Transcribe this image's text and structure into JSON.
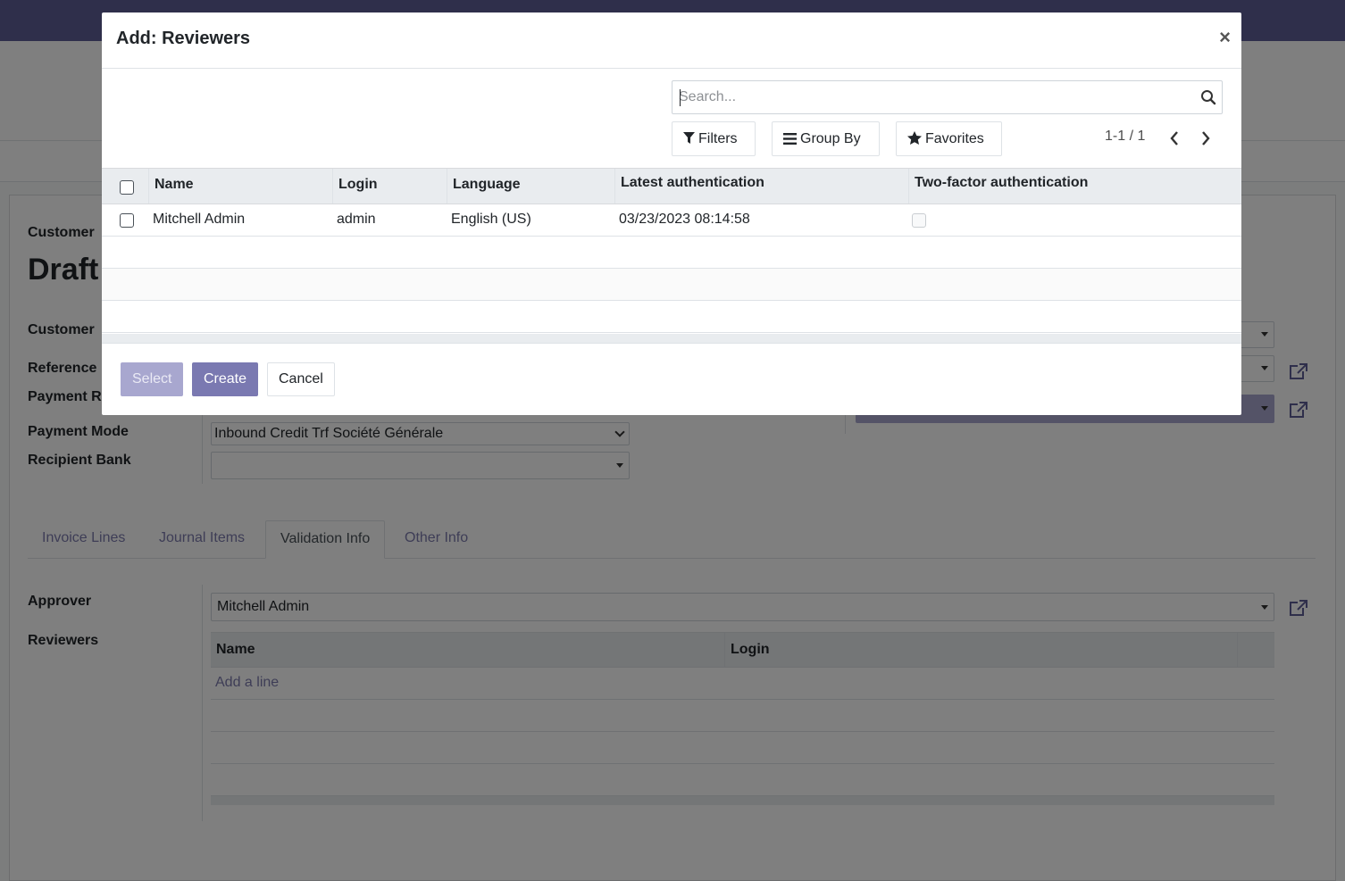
{
  "background": {
    "form": {
      "customer_label": "Customer",
      "title": "Draft",
      "customer_field_label": "Customer",
      "reference_label": "Reference",
      "payment_ref_label": "Payment R",
      "payment_mode_label": "Payment Mode",
      "payment_mode_value": "Inbound Credit Trf Société Générale",
      "recipient_bank_label": "Recipient Bank",
      "recipient_bank_value": ""
    },
    "tabs": [
      {
        "label": "Invoice Lines"
      },
      {
        "label": "Journal Items"
      },
      {
        "label": "Validation Info"
      },
      {
        "label": "Other Info"
      }
    ],
    "validation": {
      "approver_label": "Approver",
      "approver_value": "Mitchell Admin",
      "reviewers_label": "Reviewers",
      "columns": [
        "Name",
        "Login"
      ],
      "add_line": "Add a line"
    }
  },
  "dialog": {
    "title": "Add: Reviewers",
    "close_glyph": "×",
    "search": {
      "placeholder": "Search...",
      "value": ""
    },
    "filters_label": "Filters",
    "group_by_label": "Group By",
    "favorites_label": "Favorites",
    "pager": {
      "value": "1-1 / 1"
    },
    "columns": [
      "Name",
      "Login",
      "Language",
      "Latest authentication",
      "Two-factor authentication"
    ],
    "rows": [
      {
        "name": "Mitchell Admin",
        "login": "admin",
        "language": "English (US)",
        "latest_auth": "03/23/2023 08:14:58",
        "two_factor": false
      }
    ],
    "buttons": {
      "select": "Select",
      "create": "Create",
      "cancel": "Cancel"
    }
  }
}
